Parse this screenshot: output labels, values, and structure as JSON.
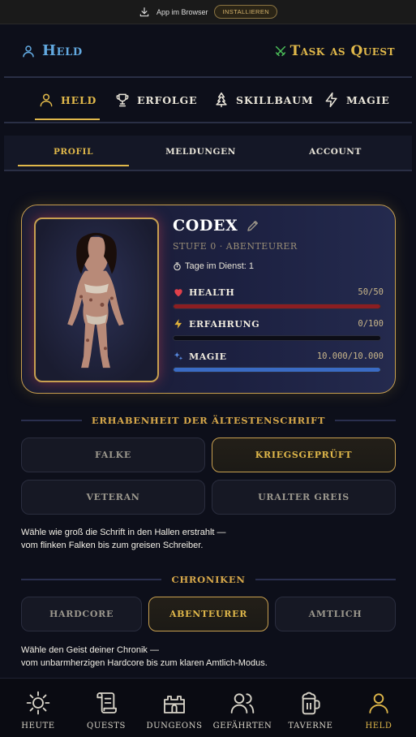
{
  "install_bar": {
    "text": "App im Browser",
    "button": "INSTALLIEREN"
  },
  "header": {
    "section_title": "Held",
    "app_title": "Task as Quest"
  },
  "main_tabs": [
    {
      "label": "HELD",
      "icon": "user-icon",
      "active": true
    },
    {
      "label": "ERFOLGE",
      "icon": "trophy-icon",
      "active": false
    },
    {
      "label": "SKILLBAUM",
      "icon": "tree-icon",
      "active": false
    },
    {
      "label": "MAGIE",
      "icon": "lightning-icon",
      "active": false
    }
  ],
  "sub_tabs": [
    {
      "label": "PROFIL",
      "active": true
    },
    {
      "label": "MELDUNGEN",
      "active": false
    },
    {
      "label": "ACCOUNT",
      "active": false
    }
  ],
  "profile": {
    "name": "CODEX",
    "level_line": "STUFE 0 · ABENTEURER",
    "days_label": "Tage im Dienst: 1",
    "stats": [
      {
        "label": "HEALTH",
        "value_text": "50/50",
        "fraction": 1.0,
        "color": "#8c1e22",
        "icon": "heart-icon"
      },
      {
        "label": "ERFAHRUNG",
        "value_text": "0/100",
        "fraction": 0.0,
        "color": "#d9a640",
        "icon": "bolt-icon"
      },
      {
        "label": "MAGIE",
        "value_text": "10.000/10.000",
        "fraction": 1.0,
        "color": "#3a6bc4",
        "icon": "sparkle-icon"
      }
    ]
  },
  "font_section": {
    "title": "ERHABENHEIT DER ÄLTESTENSCHRIFT",
    "options": [
      {
        "label": "FALKE",
        "active": false
      },
      {
        "label": "KRIEGSGEPRÜFT",
        "active": true
      },
      {
        "label": "VETERAN",
        "active": false
      },
      {
        "label": "URALTER GREIS",
        "active": false
      }
    ],
    "help_line1": "Wähle wie groß die Schrift in den Hallen erstrahlt —",
    "help_line2": "vom flinken Falken bis zum greisen Schreiber."
  },
  "chronicle_section": {
    "title": "CHRONIKEN",
    "options": [
      {
        "label": "HARDCORE",
        "active": false
      },
      {
        "label": "ABENTEURER",
        "active": true
      },
      {
        "label": "AMTLICH",
        "active": false
      }
    ],
    "help_line1": "Wähle den Geist deiner Chronik —",
    "help_line2": "vom unbarmherzigen Hardcore bis zum klaren Amtlich-Modus."
  },
  "bottom_nav": [
    {
      "label": "HEUTE",
      "icon": "sun-icon",
      "active": false
    },
    {
      "label": "QUESTS",
      "icon": "scroll-icon",
      "active": false
    },
    {
      "label": "DUNGEONS",
      "icon": "castle-icon",
      "active": false
    },
    {
      "label": "GEFÄHRTEN",
      "icon": "users-icon",
      "active": false
    },
    {
      "label": "TAVERNE",
      "icon": "beer-icon",
      "active": false
    },
    {
      "label": "HELD",
      "icon": "user-icon",
      "active": true
    }
  ],
  "colors": {
    "accent": "#e0b84a",
    "hero_blue": "#62a9e0",
    "background": "#0d0f1a"
  }
}
